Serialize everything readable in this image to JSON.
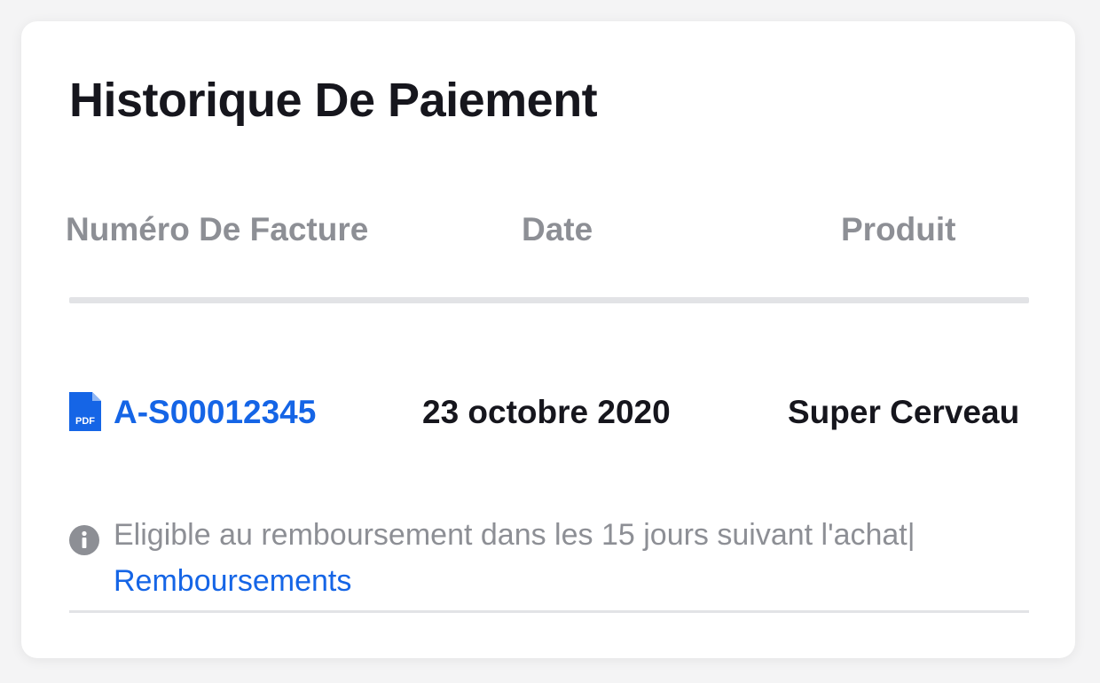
{
  "payment_history": {
    "title": "Historique De Paiement",
    "columns": {
      "invoice_number": "Numéro De Facture",
      "date": "Date",
      "product": "Produit"
    },
    "rows": [
      {
        "file_icon": "pdf-file-icon",
        "file_icon_label": "PDF",
        "invoice_number": "A-S00012345",
        "date": "23 octobre 2020",
        "product": "Super Cerveau"
      }
    ],
    "notice": {
      "icon": "info-icon",
      "text": "Eligible au remboursement dans les 15 jours suivant l'achat|",
      "link_label": "Remboursements"
    }
  },
  "colors": {
    "accent": "#1565e6",
    "text_primary": "#16161d",
    "text_muted": "#8d8f95",
    "divider": "#e2e3e6",
    "background": "#ffffff"
  }
}
